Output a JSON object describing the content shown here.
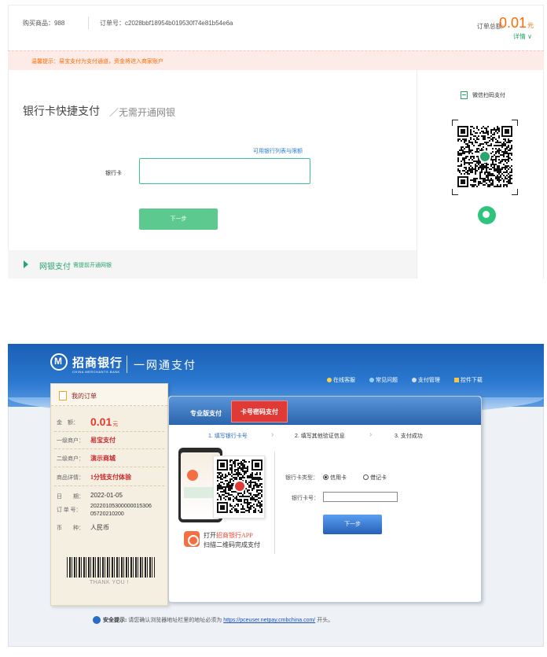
{
  "order": {
    "product_label": "购买商品：",
    "product_value": "988",
    "order_no_label": "订单号：",
    "order_no_value": "c2028bbf18954b019530f74e81b54e6a",
    "total_label": "订单总额:",
    "total_value": "0.01",
    "total_unit": "元",
    "detail_link": "详情 ∨"
  },
  "notice": {
    "prefix": "温馨提示：",
    "text": "易宝支付为支付通道，资金将进入商家账户"
  },
  "method": {
    "title": "银行卡快捷支付",
    "subtitle": "／无需开通网银",
    "bank_limits_link": "可用银行列表与限额",
    "card_label": "银行卡",
    "card_value": "",
    "next_button": "下一步"
  },
  "netbank": {
    "label": "网银支付",
    "sub": "需提前开通网银"
  },
  "wechat": {
    "scan_label": "微信扫码支付",
    "icon": "wechat-icon"
  },
  "cmb": {
    "bank_name": "招商银行",
    "bank_en": "CHINA MERCHANTS BANK",
    "slogan": "一网通支付",
    "links": [
      "在线客服",
      "常见问题",
      "支付管理",
      "控件下载"
    ],
    "receipt": {
      "title": "我的订单",
      "amount_label": "金　额：",
      "amount_value": "0.01",
      "amount_unit": "元",
      "merchant1_label": "一级商户：",
      "merchant1_value": "易宝支付",
      "merchant2_label": "二级商户：",
      "merchant2_value": "演示商城",
      "goods_label": "商品详情：",
      "goods_value": "1分钱支付体验",
      "date_label": "日　　期：",
      "date_value": "2022-01-05",
      "order_label": "订 单 号：",
      "order_value_1": "20220105300000015306",
      "order_value_2": "05720210200",
      "currency_label": "币　　种：",
      "currency_value": "人民币",
      "thankyou": "THANK YOU !"
    },
    "tabs": [
      "专业版支付",
      "卡号密码支付"
    ],
    "steps": [
      "1. 填写银行卡号",
      "2. 填写其他验证信息",
      "3. 支付成功"
    ],
    "app_line1_prefix": "打开",
    "app_line1_highlight": "招商银行APP",
    "app_line2": "扫描二维码完成支付",
    "card_type_label": "银行卡类型：",
    "card_type_options": [
      "信用卡",
      "借记卡"
    ],
    "card_no_label": "银行卡号：",
    "card_no_value": "",
    "next_button": "下一步",
    "security_label": "安全提示:",
    "security_text": "请您确认浏览器地址栏里的地址必须为",
    "security_url": "https://pceuser.netpay.cmbchina.com/",
    "security_suffix": "开头。"
  },
  "colors": {
    "accent_green": "#2aa56b",
    "price_orange": "#ff6a00",
    "cmb_blue": "#1a5fb4",
    "cmb_red": "#e03a36"
  }
}
